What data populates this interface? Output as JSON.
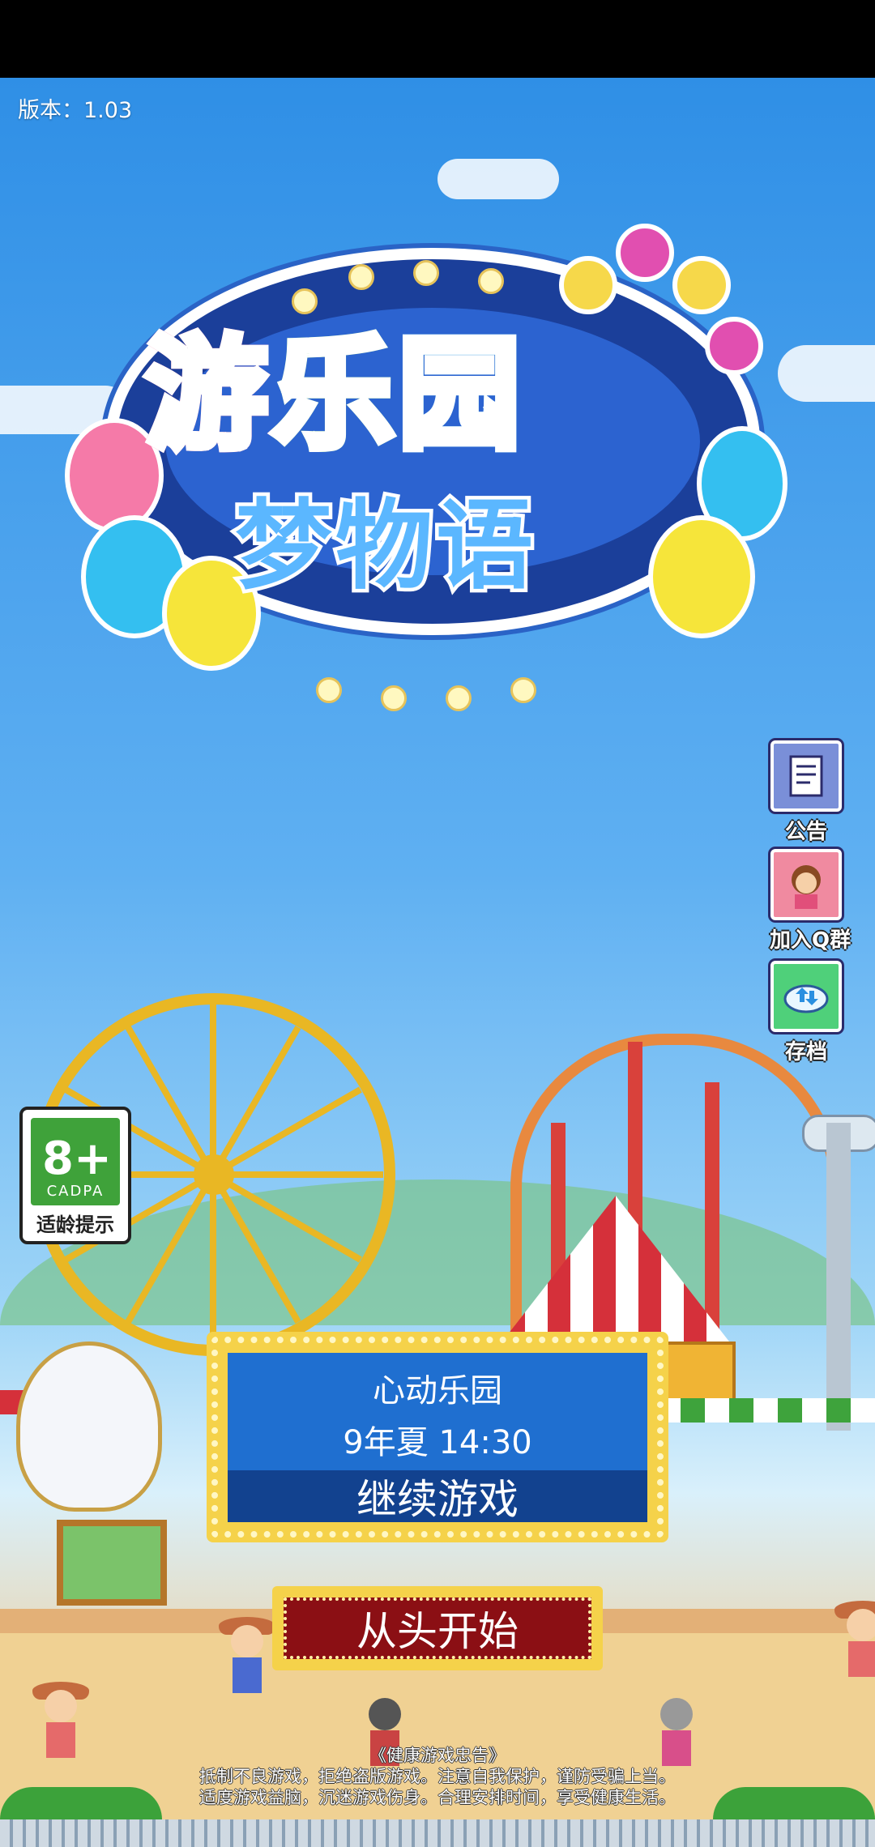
{
  "version": {
    "label": "版本：1.03"
  },
  "logo": {
    "line1": "游乐园",
    "line2": "梦物语"
  },
  "side_menu": [
    {
      "label": "公告",
      "icon": "notice-icon"
    },
    {
      "label": "加入Q群",
      "icon": "character-icon"
    },
    {
      "label": "存档",
      "icon": "cloud-save-icon"
    }
  ],
  "age_rating": {
    "age": "8+",
    "org": "CADPA",
    "hint": "适龄提示"
  },
  "save_panel": {
    "park_name": "心动乐园",
    "game_time": "9年夏 14:30",
    "continue_label": "继续游戏"
  },
  "restart_label": "从头开始",
  "health_notice": {
    "title": "《健康游戏忠告》",
    "line1": "抵制不良游戏，拒绝盗版游戏。注意自我保护，谨防受骗上当。",
    "line2": "适度游戏益脑，沉迷游戏伤身。合理安排时间，享受健康生活。"
  },
  "colors": {
    "sky": "#2f8fe6",
    "panel_gold": "#f5d24a",
    "panel_blue": "#1f6fd0",
    "restart_red": "#8b0f14"
  }
}
